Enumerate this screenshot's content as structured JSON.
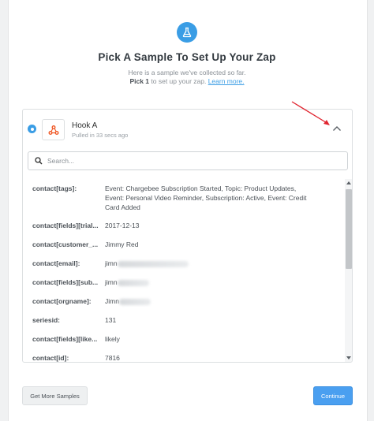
{
  "header": {
    "title": "Pick A Sample To Set Up Your Zap",
    "subtitle": "Here is a sample we've collected so far.",
    "pick_bold": "Pick 1",
    "pick_rest": " to set up your zap. ",
    "learn_more": "Learn more."
  },
  "sample": {
    "name": "Hook A",
    "pulled": "Pulled in 33 secs ago"
  },
  "search": {
    "placeholder": "Search..."
  },
  "fields": [
    {
      "key": "contact[tags]:",
      "value": "Event: Chargebee Subscription Started, Topic: Product Updates, Event: Personal Video Reminder, Subscription: Active, Event: Credit Card Added"
    },
    {
      "key": "contact[fields][trial...",
      "value": "2017-12-13"
    },
    {
      "key": "contact[customer_...",
      "value": "Jimmy Red"
    },
    {
      "key": "contact[email]:",
      "value": "jimn"
    },
    {
      "key": "contact[fields][sub...",
      "value": "jimn"
    },
    {
      "key": "contact[orgname]:",
      "value": "Jimn"
    },
    {
      "key": "seriesid:",
      "value": "131"
    },
    {
      "key": "contact[fields][like...",
      "value": "likely"
    },
    {
      "key": "contact[id]:",
      "value": "7816"
    }
  ],
  "footer": {
    "more_label": "Get More Samples",
    "continue_label": "Continue"
  },
  "colors": {
    "accent": "#3a9de5",
    "annotation": "#e0242f"
  }
}
